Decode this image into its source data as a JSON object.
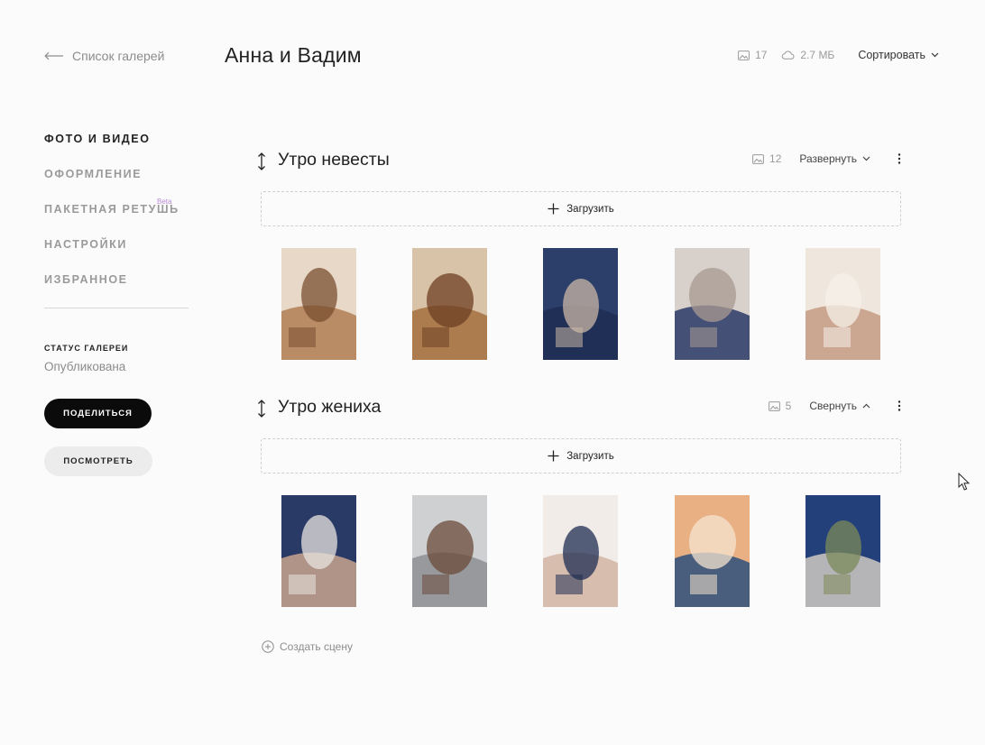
{
  "header": {
    "back_label": "Список галерей",
    "title": "Анна и Вадим",
    "photo_count": "17",
    "storage": "2.7 МБ",
    "sort_label": "Сортировать"
  },
  "sidebar": {
    "items": [
      {
        "label": "ФОТО И ВИДЕО",
        "active": true
      },
      {
        "label": "ОФОРМЛЕНИЕ",
        "active": false
      },
      {
        "label": "ПАКЕТНАЯ РЕТУШЬ",
        "active": false,
        "badge": "Beta"
      },
      {
        "label": "НАСТРОЙКИ",
        "active": false
      },
      {
        "label": "ИЗБРАННОЕ",
        "active": false
      }
    ],
    "status_label": "СТАТУС ГАЛЕРЕИ",
    "status_value": "Опубликована",
    "share_label": "ПОДЕЛИТЬСЯ",
    "view_label": "ПОСМОТРЕТЬ"
  },
  "scenes": [
    {
      "title": "Утро невесты",
      "count": "12",
      "toggle_label": "Развернуть",
      "expanded": false,
      "upload_label": "Загрузить",
      "photos": [
        {
          "subject": "chair-and-shoes",
          "colors": [
            "#e8d8c8",
            "#b07f55",
            "#7a4f30"
          ]
        },
        {
          "subject": "mirror-and-heels",
          "colors": [
            "#d9c3a8",
            "#a3703f",
            "#6e3f22"
          ]
        },
        {
          "subject": "groom-suit-cufflinks",
          "colors": [
            "#2c3f6b",
            "#1f2d52",
            "#c9b7a6"
          ]
        },
        {
          "subject": "groom-mirror-reflection",
          "colors": [
            "#d8d0cb",
            "#2a3a66",
            "#a89a92"
          ]
        },
        {
          "subject": "bride-dress-back",
          "colors": [
            "#efe6dd",
            "#c49a82",
            "#f5f0ea"
          ]
        }
      ]
    },
    {
      "title": "Утро жениха",
      "count": "5",
      "toggle_label": "Свернуть",
      "expanded": true,
      "upload_label": "Загрузить",
      "photos": [
        {
          "subject": "groom-boutonniere",
          "colors": [
            "#2a3a66",
            "#c9a58e",
            "#e8e4e0"
          ]
        },
        {
          "subject": "groom-vest",
          "colors": [
            "#cfd0d2",
            "#8d8f94",
            "#6b4b3a"
          ]
        },
        {
          "subject": "hands-cufflinks",
          "colors": [
            "#f1ece8",
            "#d2b5a3",
            "#1f2d52"
          ]
        },
        {
          "subject": "room-suit-on-bed",
          "colors": [
            "#e9b083",
            "#2d4f7c",
            "#f4e4d0"
          ]
        },
        {
          "subject": "groom-tie-closeup",
          "colors": [
            "#24407a",
            "#cfc9c2",
            "#7b8a5a"
          ]
        }
      ]
    }
  ],
  "create_scene_label": "Создать сцену"
}
